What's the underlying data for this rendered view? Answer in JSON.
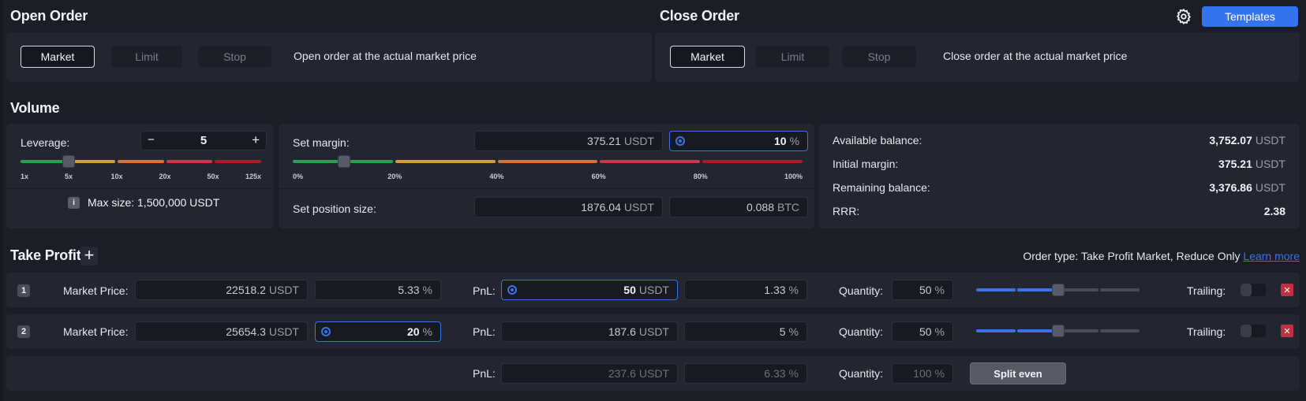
{
  "open_order": {
    "title": "Open Order",
    "tabs": [
      {
        "label": "Market",
        "active": true
      },
      {
        "label": "Limit",
        "active": false
      },
      {
        "label": "Stop",
        "active": false
      }
    ],
    "description": "Open order at the actual market price"
  },
  "close_order": {
    "title": "Close Order",
    "tabs": [
      {
        "label": "Market",
        "active": true
      },
      {
        "label": "Limit",
        "active": false
      },
      {
        "label": "Stop",
        "active": false
      }
    ],
    "description": "Close order at the actual market price"
  },
  "toolbar": {
    "settings_icon": "gear-icon",
    "templates_label": "Templates"
  },
  "volume": {
    "title": "Volume",
    "leverage": {
      "label": "Leverage:",
      "value": "5",
      "minus": "−",
      "plus": "+",
      "ticks": [
        "1x",
        "5x",
        "10x",
        "20x",
        "50x",
        "125x"
      ],
      "slider_tick_index": 1
    },
    "max_size": {
      "info_icon": "i",
      "text": "Max size: 1,500,000 USDT"
    },
    "margin": {
      "label": "Set margin:",
      "amount": "375.21",
      "amount_unit": "USDT",
      "percent": "10",
      "percent_unit": "%",
      "slider_percent": 10,
      "ticks": [
        "0%",
        "20%",
        "40%",
        "60%",
        "80%",
        "100%"
      ]
    },
    "position_size": {
      "label": "Set position size:",
      "usdt": "1876.04",
      "usdt_unit": "USDT",
      "btc": "0.088",
      "btc_unit": "BTC"
    },
    "balance": [
      {
        "label": "Available balance:",
        "value": "3,752.07",
        "unit": "USDT"
      },
      {
        "label": "Initial margin:",
        "value": "375.21",
        "unit": "USDT"
      },
      {
        "label": "Remaining balance:",
        "value": "3,376.86",
        "unit": "USDT"
      },
      {
        "label": "RRR:",
        "value": "2.38",
        "unit": ""
      }
    ]
  },
  "take_profit": {
    "title": "Take Profit",
    "add_label": "+",
    "order_type_text": "Order type: Take Profit Market, Reduce Only",
    "learn_more": "Learn more",
    "price_label": "Market Price:",
    "pnl_label": "PnL:",
    "quantity_label": "Quantity:",
    "trailing_label": "Trailing:",
    "rows": [
      {
        "index": "1",
        "price": "22518.2",
        "price_unit": "USDT",
        "price_pct": "5.33",
        "pct_unit": "%",
        "pnl": "50",
        "pnl_unit": "USDT",
        "pnl_pct": "1.33",
        "quantity": "50",
        "qty_unit": "%",
        "quantity_percent": 50,
        "trailing": false
      },
      {
        "index": "2",
        "price": "25654.3",
        "price_unit": "USDT",
        "price_pct": "20",
        "pct_unit": "%",
        "pnl": "187.6",
        "pnl_unit": "USDT",
        "pnl_pct": "5",
        "quantity": "50",
        "qty_unit": "%",
        "quantity_percent": 50,
        "trailing": false
      }
    ],
    "total": {
      "pnl": "237.6",
      "pnl_unit": "USDT",
      "pnl_pct": "6.33",
      "pct_unit": "%",
      "quantity": "100",
      "qty_unit": "%",
      "split_label": "Split even"
    },
    "colors": {
      "accent": "#3b73e6",
      "danger": "#c0303e"
    }
  }
}
